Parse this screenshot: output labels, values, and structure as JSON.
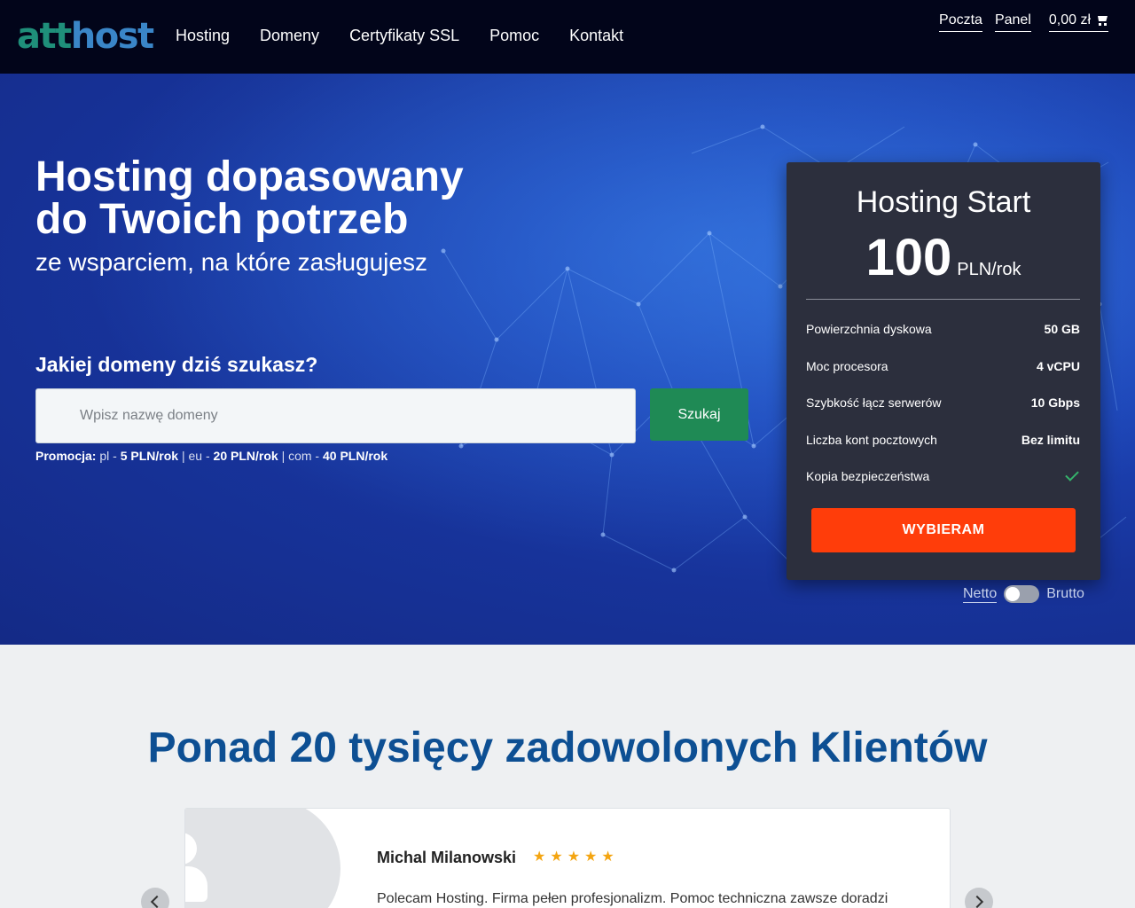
{
  "header": {
    "logo": {
      "part1": "att",
      "part2": "host"
    },
    "nav": [
      "Hosting",
      "Domeny",
      "Certyfikaty SSL",
      "Pomoc",
      "Kontakt"
    ],
    "top_links": [
      "Poczta",
      "Panel"
    ],
    "cart_total": "0,00 zł",
    "cart_icon": "cart-icon"
  },
  "hero": {
    "title_line1": "Hosting dopasowany",
    "title_line2": "do Twoich potrzeb",
    "subtitle": "ze wsparciem, na które zasługujesz",
    "domain_question": "Jakiej domeny dziś szukasz?",
    "search_placeholder": "Wpisz nazwę domeny",
    "search_button": "Szukaj",
    "promo": {
      "label": "Promocja:",
      "items": [
        {
          "tld": "pl",
          "price": "5 PLN/rok"
        },
        {
          "tld": "eu",
          "price": "20 PLN/rok"
        },
        {
          "tld": "com",
          "price": "40 PLN/rok"
        }
      ]
    }
  },
  "plan": {
    "name": "Hosting Start",
    "price": "100",
    "unit": "PLN/rok",
    "features": [
      {
        "label": "Powierzchnia dyskowa",
        "value": "50 GB"
      },
      {
        "label": "Moc procesora",
        "value": "4 vCPU"
      },
      {
        "label": "Szybkość łącz serwerów",
        "value": "10 Gbps"
      },
      {
        "label": "Liczba kont pocztowych",
        "value": "Bez limitu"
      },
      {
        "label": "Kopia bezpieczeństwa",
        "value": "",
        "icon": "check-icon"
      }
    ],
    "cta": "WYBIERAM",
    "toggle": {
      "left": "Netto",
      "right": "Brutto",
      "brutto_selected": false
    }
  },
  "clients": {
    "title": "Ponad 20 tysięcy zadowolonych Klientów",
    "review": {
      "name": "Michal Milanowski",
      "stars": "★★★★★",
      "text": "Polecam Hosting. Firma pełen profesjonalizm. Pomoc techniczna zawsze doradzi"
    }
  }
}
